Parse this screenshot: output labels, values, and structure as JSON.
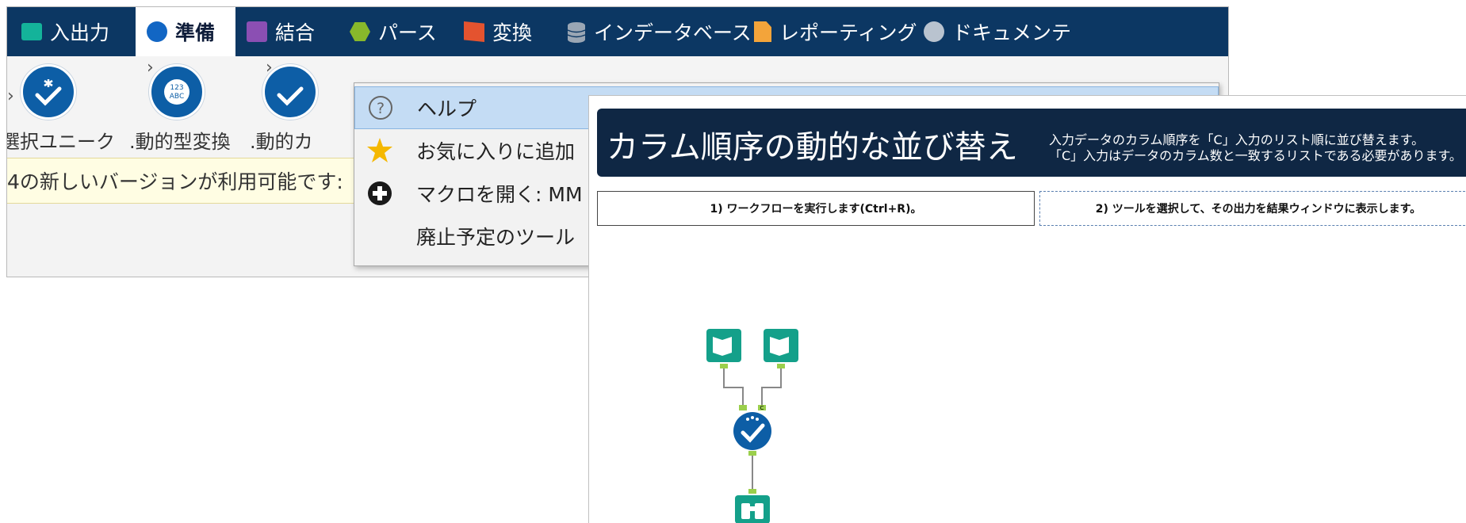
{
  "tabs": [
    {
      "label": "入出力",
      "icon": "folder-icon"
    },
    {
      "label": "準備",
      "icon": "circle-icon"
    },
    {
      "label": "結合",
      "icon": "square-icon"
    },
    {
      "label": "パース",
      "icon": "hexagon-icon"
    },
    {
      "label": "変換",
      "icon": "flag-icon"
    },
    {
      "label": "インデータベース",
      "icon": "database-icon"
    },
    {
      "label": "レポーティング",
      "icon": "document-icon"
    },
    {
      "label": "ドキュメンテ",
      "icon": "comment-icon"
    }
  ],
  "active_tab": "準備",
  "tools": [
    {
      "label": "選択ユニーク"
    },
    {
      "label": ".動的型変換"
    },
    {
      "label": ".動的カ"
    }
  ],
  "notice": {
    "text": "4の新しいバージョンが利用可能です:"
  },
  "context_menu": {
    "items": [
      {
        "label": "ヘルプ",
        "icon": "question-icon"
      },
      {
        "label": "お気に入りに追加",
        "icon": "star-icon"
      },
      {
        "label": "マクロを開く: MM",
        "icon": "plus-circle-icon"
      },
      {
        "label": "廃止予定のツール",
        "icon": ""
      }
    ]
  },
  "help": {
    "title": "カラム順序の動的な並び替え",
    "description_line1": "入力データのカラム順序を「C」入力のリスト順に並び替えます。",
    "description_line2": "「C」入力はデータのカラム数と一致するリストである必要があります。",
    "step1": "1) ワークフローを実行します(Ctrl+R)。",
    "step2": "2) ツールを選択して、その出力を結果ウィンドウに表示します。"
  },
  "workflow": {
    "anchor_label": "C",
    "nodes": [
      "book-input-icon",
      "book-input-icon",
      "dynamic-select-icon",
      "browse-binoculars-icon"
    ]
  },
  "colors": {
    "tabbar": "#0c3763",
    "help_header": "#0f2744",
    "tool_blue": "#0d5ea6",
    "workflow_teal": "#14a08a",
    "connector_green": "#9bcf4c",
    "menu_highlight": "#c4dcf4"
  }
}
